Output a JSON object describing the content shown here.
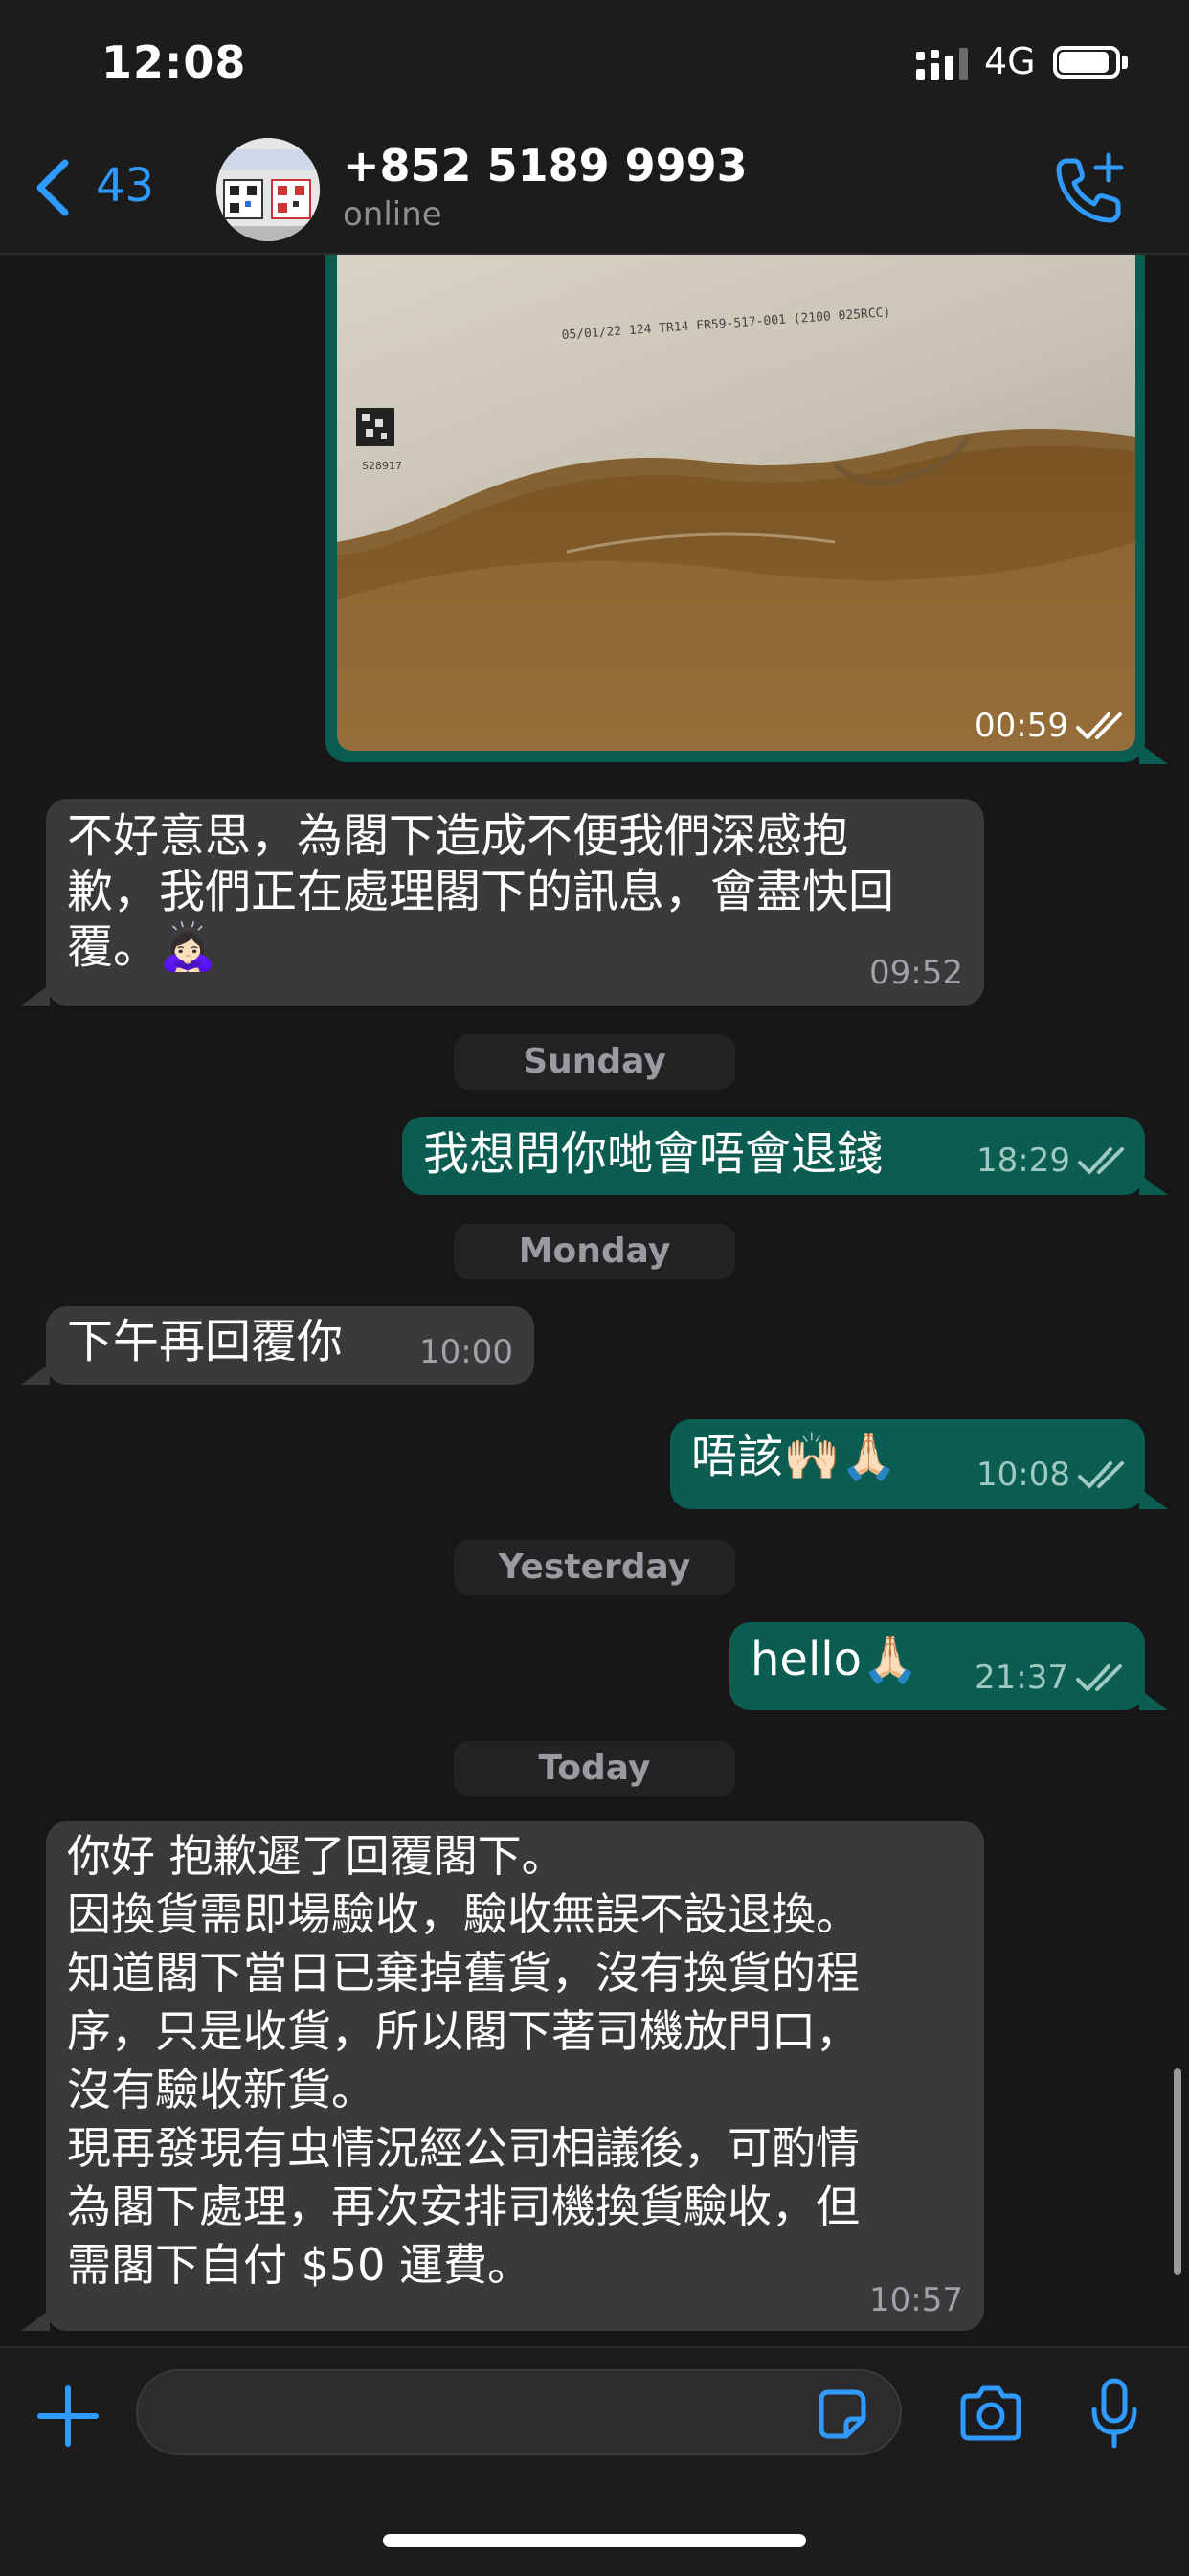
{
  "status_bar": {
    "time": "12:08",
    "network": "4G",
    "signal_icon": "cellular-signal-icon",
    "battery_icon": "battery-icon"
  },
  "header": {
    "back_count": "43",
    "contact_name": "+852 5189 9993",
    "contact_status": "online",
    "accent_color": "#2f9bff",
    "icons": [
      "chevron-left-icon",
      "add-call-icon"
    ]
  },
  "messages": {
    "image": {
      "time": "00:59",
      "status": "read",
      "receipt_text": "05/01/22 124 TR14 FR59-517-001 (2100 025RCC)",
      "code_text": "S28917"
    },
    "m1": {
      "text": "不好意思，為閣下造成不便我們深感抱\n歉，我們正在處理閣下的訊息，會盡快回\n覆。🙇🏻‍♀️",
      "time": "09:52"
    },
    "d1": "Sunday",
    "m2": {
      "text": "我想問你哋會唔會退錢",
      "time": "18:29",
      "status": "read"
    },
    "d2": "Monday",
    "m3": {
      "text": "下午再回覆你",
      "time": "10:00"
    },
    "m4": {
      "text": "唔該🙌🏻🙏🏻",
      "time": "10:08",
      "status": "read"
    },
    "d3": "Yesterday",
    "m5": {
      "text": "hello🙏🏻",
      "time": "21:37",
      "status": "read"
    },
    "d4": "Today",
    "m6": {
      "text": "你好 抱歉遲了回覆閣下。\n因換貨需即場驗收，驗收無誤不設退換。\n知道閣下當日已棄掉舊貨，沒有換貨的程\n序，只是收貨，所以閣下著司機放門口，\n沒有驗收新貨。\n現再發現有虫情況經公司相議後，可酌情\n為閣下處理，再次安排司機換貨驗收，但\n需閣下自付 $50 運費。",
      "time": "10:57"
    }
  },
  "input_bar": {
    "icons": [
      "plus-icon",
      "sticker-icon",
      "camera-icon",
      "microphone-icon"
    ]
  },
  "colors": {
    "incoming_bubble": "#3a3a3c",
    "outgoing_bubble": "#0b5d52",
    "background": "#171717"
  }
}
